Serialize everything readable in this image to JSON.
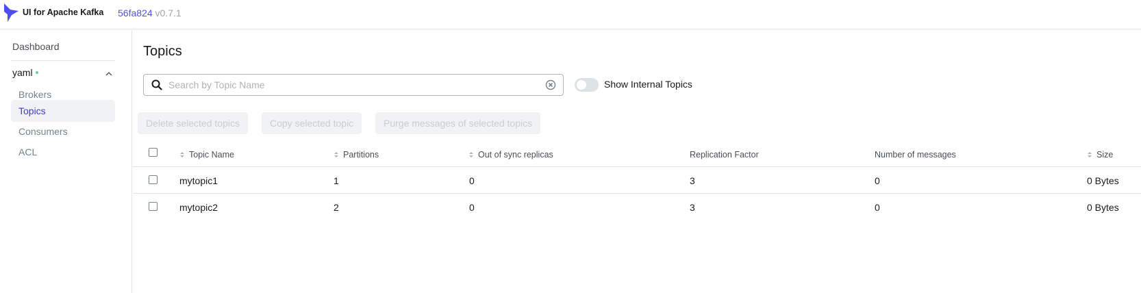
{
  "header": {
    "app_title": "UI for Apache Kafka",
    "commit_hash": "56fa824",
    "version": "v0.7.1"
  },
  "sidebar": {
    "dashboard": "Dashboard",
    "cluster": {
      "name": "yaml",
      "status_color": "#5cd685"
    },
    "items": [
      {
        "label": "Brokers",
        "active": false
      },
      {
        "label": "Topics",
        "active": true
      },
      {
        "label": "Consumers",
        "active": false
      },
      {
        "label": "ACL",
        "active": false
      }
    ]
  },
  "main": {
    "title": "Topics",
    "search": {
      "placeholder": "Search by Topic Name",
      "value": ""
    },
    "internal_toggle": {
      "label": "Show Internal Topics",
      "on": false
    },
    "actions": {
      "delete": "Delete selected topics",
      "copy": "Copy selected topic",
      "purge": "Purge messages of selected topics"
    },
    "table": {
      "columns": [
        "Topic Name",
        "Partitions",
        "Out of sync replicas",
        "Replication Factor",
        "Number of messages",
        "Size"
      ],
      "rows": [
        {
          "name": "mytopic1",
          "partitions": "1",
          "out_of_sync": "0",
          "replication": "3",
          "messages": "0",
          "size": "0 Bytes"
        },
        {
          "name": "mytopic2",
          "partitions": "2",
          "out_of_sync": "0",
          "replication": "3",
          "messages": "0",
          "size": "0 Bytes"
        }
      ]
    }
  },
  "colors": {
    "accent": "#4f4ff0",
    "active_nav_text": "#3f3fc1",
    "active_nav_bg": "#f1f2f3",
    "border": "#e3e6e8"
  }
}
